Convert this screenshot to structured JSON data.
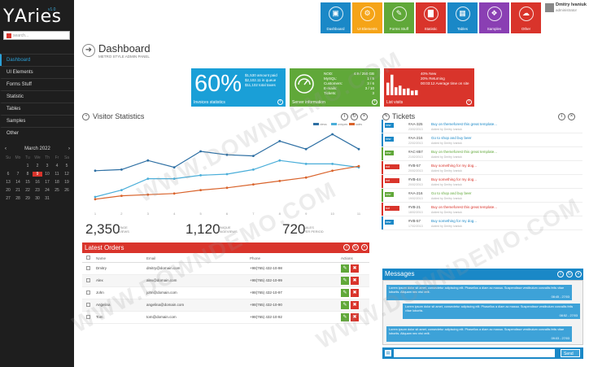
{
  "sidebar": {
    "logo": "ΥAries",
    "version": "v1.0",
    "search_placeholder": "search...",
    "items": [
      "Dashboard",
      "UI Elements",
      "Forms Stuff",
      "Statistic",
      "Tables",
      "Samples",
      "Other"
    ],
    "calendar": {
      "month": "March 2022",
      "days": [
        "Su",
        "Mo",
        "Tu",
        "We",
        "Th",
        "Fr",
        "Sa"
      ],
      "dates": [
        [
          "",
          "",
          "1",
          "2",
          "3",
          "4",
          "5"
        ],
        [
          "6",
          "7",
          "8",
          "9",
          "10",
          "11",
          "12"
        ],
        [
          "13",
          "14",
          "15",
          "16",
          "17",
          "18",
          "19"
        ],
        [
          "20",
          "21",
          "22",
          "23",
          "24",
          "25",
          "26"
        ],
        [
          "27",
          "28",
          "29",
          "30",
          "31",
          "",
          ""
        ]
      ],
      "today": "9"
    }
  },
  "tiles": [
    {
      "label": "Dashboard",
      "color": "#1a88c7",
      "icon": "monitor-icon",
      "glyph": "▣"
    },
    {
      "label": "UI Elements",
      "color": "#f5a418",
      "icon": "settings-icon",
      "glyph": "⚙"
    },
    {
      "label": "Forms Stuff",
      "color": "#60a839",
      "icon": "pencil-icon",
      "glyph": "✎"
    },
    {
      "label": "Statistic",
      "color": "#d9342b",
      "icon": "chart-icon",
      "glyph": "▇"
    },
    {
      "label": "Tables",
      "color": "#1a88c7",
      "icon": "grid-icon",
      "glyph": "▦"
    },
    {
      "label": "Samples",
      "color": "#8a3fb3",
      "icon": "gift-icon",
      "glyph": "❖"
    },
    {
      "label": "Other",
      "color": "#d9342b",
      "icon": "cloud-icon",
      "glyph": "☁"
    }
  ],
  "user": {
    "name": "Dmitry Ivaniuk",
    "role": "administrator"
  },
  "page": {
    "title": "Dashboard",
    "subtitle": "METRO STYLE ADMIN PANEL"
  },
  "stats": {
    "invoices": {
      "percent": "60%",
      "lines": [
        "$1,530 amount paid",
        "$2,102.11 in queue",
        "$11,102 total taxes"
      ],
      "footer": "Invoices statistics",
      "color": "#1a9fd7"
    },
    "server": {
      "rows": [
        [
          "NOD:",
          "4.9 / 250 GB"
        ],
        [
          "MySQL:",
          "1 / 5"
        ],
        [
          "Customers:",
          "3 / 6"
        ],
        [
          "E-mails:",
          "3 / 10"
        ],
        [
          "Tickets:",
          "3"
        ]
      ],
      "footer": "Server information",
      "color": "#60a839"
    },
    "visits": {
      "lines": [
        "40% New",
        "20% Returning",
        "00:03:12 Average time on site"
      ],
      "footer": "List visits",
      "color": "#d9342b",
      "bars": [
        0.55,
        0.9,
        0.35,
        0.42,
        0.28,
        0.3,
        0.2,
        0.22
      ]
    }
  },
  "visitors": {
    "title": "Visitor Statistics",
    "big": [
      {
        "value": "2,350",
        "label": [
          "PAGE",
          "VIEWS"
        ],
        "color": "#1a88c7"
      },
      {
        "value": "1,120",
        "label": [
          "UNIQUE",
          "PAGEVIEWS"
        ],
        "color": "#1a88c7"
      },
      {
        "value": "720",
        "label": [
          "SALES",
          "PER PERIOD"
        ],
        "color": "#d9632b"
      }
    ]
  },
  "chart_data": {
    "type": "line",
    "x": [
      "1",
      "2",
      "3",
      "4",
      "5",
      "6",
      "7",
      "8",
      "9",
      "10",
      "11"
    ],
    "series": [
      {
        "name": "views",
        "color": "#2d6fa3",
        "values": [
          63,
          64,
          72,
          66,
          80,
          77,
          76,
          89,
          82,
          95,
          82
        ]
      },
      {
        "name": "uniques",
        "color": "#4aaed9",
        "values": [
          40,
          46,
          56,
          56,
          59,
          60,
          64,
          72,
          69,
          69,
          66
        ]
      },
      {
        "name": "sales",
        "color": "#d9632b",
        "values": [
          38,
          41,
          42,
          43,
          46,
          48,
          51,
          54,
          57,
          63,
          67
        ]
      }
    ],
    "ylim": [
      30,
      100
    ],
    "grid": false
  },
  "orders": {
    "title": "Latest Orders",
    "columns": [
      "Name",
      "Email",
      "Phone",
      "Actions"
    ],
    "rows": [
      [
        "Dmitry",
        "dmitry@domain.com",
        "+98(765) 432-10-98"
      ],
      [
        "Alex",
        "alex@domain.com",
        "+98(765) 432-10-99"
      ],
      [
        "John",
        "john@domain.com",
        "+98(765) 432-10-97"
      ],
      [
        "Angelina",
        "angelina@domain.com",
        "+98(765) 432-10-90"
      ],
      [
        "Tom",
        "tom@domain.com",
        "+98(765) 432-10-92"
      ]
    ]
  },
  "tickets": {
    "title": "Tickets",
    "rows": [
      {
        "badge": "new",
        "color": "#1a88c7",
        "id": "#AA-325",
        "date": "23/02/2013",
        "title": "Buy on themeforest this great template...",
        "added": "Added by Dmitry Ivaniuk"
      },
      {
        "badge": "new",
        "color": "#1a88c7",
        "id": "#AA-216",
        "date": "22/02/2013",
        "title": "Go to shop and buy beer",
        "added": "Added by Dmitry Ivaniuk"
      },
      {
        "badge": "new",
        "color": "#60a839",
        "id": "#AC-857",
        "date": "21/02/2013",
        "title": "Buy on themeforest this great template...",
        "added": "Added by Dmitry Ivaniuk"
      },
      {
        "badge": "not resolved",
        "color": "#d9342b",
        "id": "#VB-57",
        "date": "20/02/2013",
        "title": "Buy something for my dog...",
        "added": "Added by Dmitry Ivaniuk"
      },
      {
        "badge": "not resolved",
        "color": "#d9342b",
        "id": "#VB-44",
        "date": "20/02/2013",
        "title": "Buy something for my dog...",
        "added": "Added by Dmitry Ivaniuk"
      },
      {
        "badge": "new",
        "color": "#60a839",
        "id": "#AA-216",
        "date": "19/02/2013",
        "title": "Go to shop and buy beer",
        "added": "Added by Dmitry Ivaniuk"
      },
      {
        "badge": "not resolved",
        "color": "#d9342b",
        "id": "#VB-21",
        "date": "18/02/2013",
        "title": "Buy on themeforest this great template...",
        "added": "Added by Dmitry Ivaniuk"
      },
      {
        "badge": "new",
        "color": "#1a88c7",
        "id": "#VB-57",
        "date": "17/02/2013",
        "title": "Buy something for my dog...",
        "added": "Added by Dmitry Ivaniuk"
      }
    ]
  },
  "messages": {
    "title": "Messages",
    "items": [
      {
        "text": "Lorem ipsum dolor sit amet, consectetur adipiscing elit. Phasellus a diam ac massa. Suspendisse vestibulum convallis felis vitae lobortis. Aliquam nec nisi velit.",
        "time": "08:45 - 27/03"
      },
      {
        "text": "Lorem ipsum dolor sit amet, consectetur adipiscing elit. Phasellus a diam ac massa. Suspendisse vestibulum convallis felis vitae lobortis.",
        "time": "08:52 - 27/03"
      },
      {
        "text": "Lorem ipsum dolor sit amet, consectetur adipiscing elit. Phasellus a diam ac massa. Suspendisse vestibulum convallis felis vitae lobortis. Aliquam nec nisi velit.",
        "time": "09:03 - 27/03"
      }
    ],
    "send": "Send"
  },
  "watermark": "WWW.DOWNDEMO.COM"
}
